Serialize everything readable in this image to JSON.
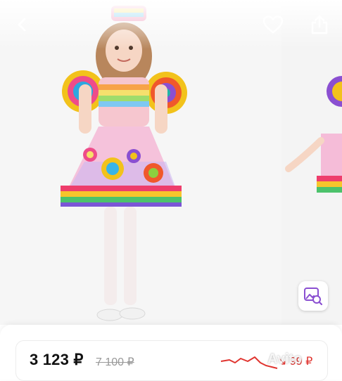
{
  "product": {
    "price": "3 123 ₽",
    "old_price": "7 100 ₽",
    "price_drop": "↘ 99 ₽"
  },
  "watermark": {
    "text": "Avito"
  },
  "icons": [
    "back-arrow-icon",
    "heart-icon",
    "share-icon",
    "image-search-icon"
  ],
  "colors": {
    "price_drop": "#e0342f",
    "old_price": "#999999",
    "background": "#f7f7f7"
  }
}
